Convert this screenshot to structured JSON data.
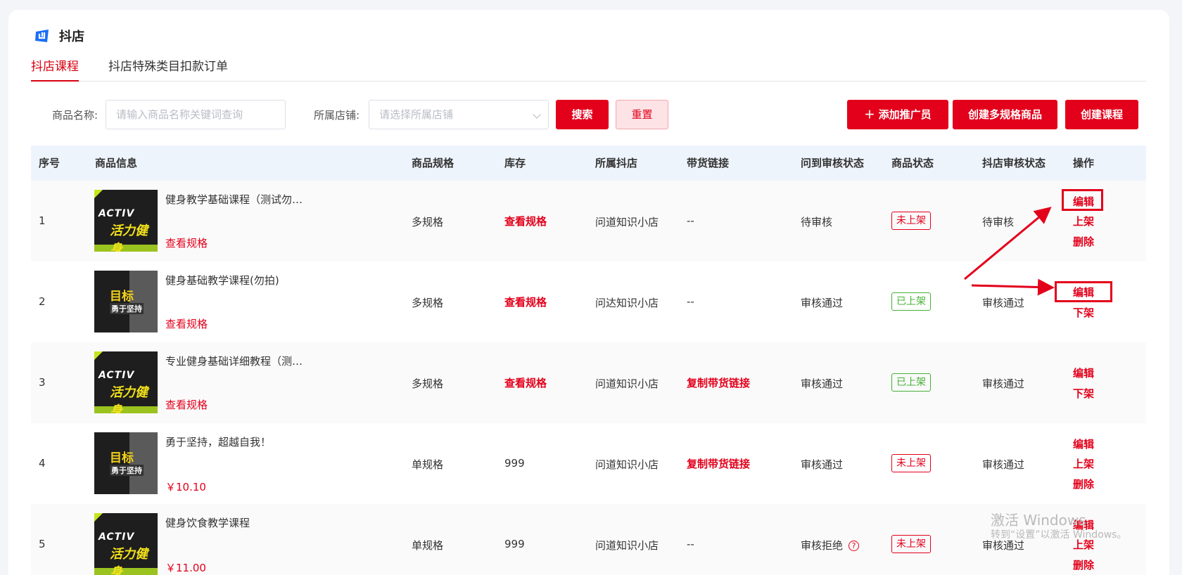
{
  "app": {
    "title": "抖店"
  },
  "tabs": [
    {
      "label": "抖店课程",
      "active": true
    },
    {
      "label": "抖店特殊类目扣款订单",
      "active": false
    }
  ],
  "filters": {
    "name_label": "商品名称:",
    "name_placeholder": "请输入商品名称关键词查询",
    "shop_label": "所属店铺:",
    "shop_placeholder": "请选择所属店铺",
    "search_label": "搜索",
    "reset_label": "重置"
  },
  "actions": {
    "add_promoter": "添加推广员",
    "create_multi_spec": "创建多规格商品",
    "create_course": "创建课程"
  },
  "table": {
    "headers": [
      "序号",
      "商品信息",
      "商品规格",
      "库存",
      "所属抖店",
      "带货链接",
      "问到审核状态",
      "商品状态",
      "抖店审核状态",
      "操作"
    ],
    "rows": [
      {
        "index": "1",
        "name": "健身教学基础课程（测试勿…",
        "sub": "查看规格",
        "spec": "多规格",
        "stock": "查看规格",
        "shop": "问道知识小店",
        "link": "--",
        "audit": "待审核",
        "status": "未上架",
        "douyin_audit": "待审核",
        "ops": [
          "编辑",
          "上架",
          "删除"
        ]
      },
      {
        "index": "2",
        "name": "健身基础教学课程(勿拍)",
        "sub": "查看规格",
        "spec": "多规格",
        "stock": "查看规格",
        "shop": "问达知识小店",
        "link": "--",
        "audit": "审核通过",
        "status": "已上架",
        "douyin_audit": "审核通过",
        "ops": [
          "编辑",
          "下架"
        ]
      },
      {
        "index": "3",
        "name": "专业健身基础详细教程（测…",
        "sub": "查看规格",
        "spec": "多规格",
        "stock": "查看规格",
        "shop": "问道知识小店",
        "link": "复制带货链接",
        "audit": "审核通过",
        "status": "已上架",
        "douyin_audit": "审核通过",
        "ops": [
          "编辑",
          "下架"
        ]
      },
      {
        "index": "4",
        "name": "勇于坚持，超越自我！",
        "sub": "￥10.10",
        "spec": "单规格",
        "stock": "999",
        "shop": "问道知识小店",
        "link": "复制带货链接",
        "audit": "审核通过",
        "status": "未上架",
        "douyin_audit": "审核通过",
        "ops": [
          "编辑",
          "上架",
          "删除"
        ]
      },
      {
        "index": "5",
        "name": "健身饮食教学课程",
        "sub": "￥11.00",
        "spec": "单规格",
        "stock": "999",
        "shop": "问道知识小店",
        "link": "--",
        "audit": "审核拒绝",
        "status": "未上架",
        "douyin_audit": "审核通过",
        "ops": [
          "编辑",
          "上架",
          "删除"
        ]
      }
    ]
  },
  "thumbs": {
    "active_text": "ACTIV",
    "active_cn": "活力健身",
    "goal_cn": "目标",
    "goal_sub": "勇于坚持"
  },
  "watermark": {
    "line1": "激活 Windows",
    "line2": "转到“设置”以激活 Windows。"
  },
  "colors": {
    "accent": "#e3001b",
    "success": "#45b035",
    "header_bg": "#eef4fc"
  }
}
